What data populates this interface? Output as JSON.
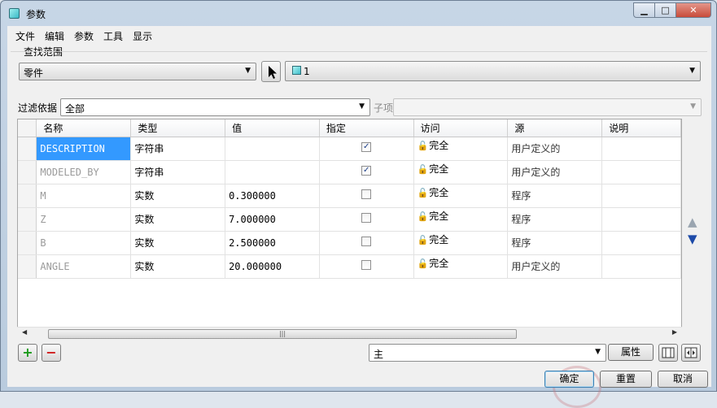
{
  "window": {
    "title": "参数",
    "icon": "cube-icon"
  },
  "window_buttons": {
    "minimize": "▁",
    "maximize": "□",
    "close": "✕"
  },
  "menu": [
    "文件",
    "编辑",
    "参数",
    "工具",
    "显示"
  ],
  "search": {
    "label": "查找范围",
    "scope_value": "零件",
    "object_value": "1"
  },
  "filter": {
    "label": "过滤依据",
    "value": "全部",
    "sub_label": "子项",
    "sub_value": ""
  },
  "table": {
    "columns": [
      "名称",
      "类型",
      "值",
      "指定",
      "访问",
      "源",
      "说明"
    ],
    "rows": [
      {
        "name": "DESCRIPTION",
        "type": "字符串",
        "value": "",
        "designated": true,
        "access": "完全",
        "source": "用户定义的",
        "desc": "",
        "selected": true
      },
      {
        "name": "MODELED_BY",
        "type": "字符串",
        "value": "",
        "designated": true,
        "access": "完全",
        "source": "用户定义的",
        "desc": ""
      },
      {
        "name": "M",
        "type": "实数",
        "value": "0.300000",
        "designated": false,
        "access": "完全",
        "source": "程序",
        "desc": ""
      },
      {
        "name": "Z",
        "type": "实数",
        "value": "7.000000",
        "designated": false,
        "access": "完全",
        "source": "程序",
        "desc": ""
      },
      {
        "name": "B",
        "type": "实数",
        "value": "2.500000",
        "designated": false,
        "access": "完全",
        "source": "程序",
        "desc": ""
      },
      {
        "name": "ANGLE",
        "type": "实数",
        "value": "20.000000",
        "designated": false,
        "access": "完全",
        "source": "用户定义的",
        "desc": ""
      }
    ]
  },
  "bottom": {
    "main_combo": "主",
    "properties_label": "属性",
    "ok_label": "确定",
    "reset_label": "重置",
    "cancel_label": "取消"
  }
}
